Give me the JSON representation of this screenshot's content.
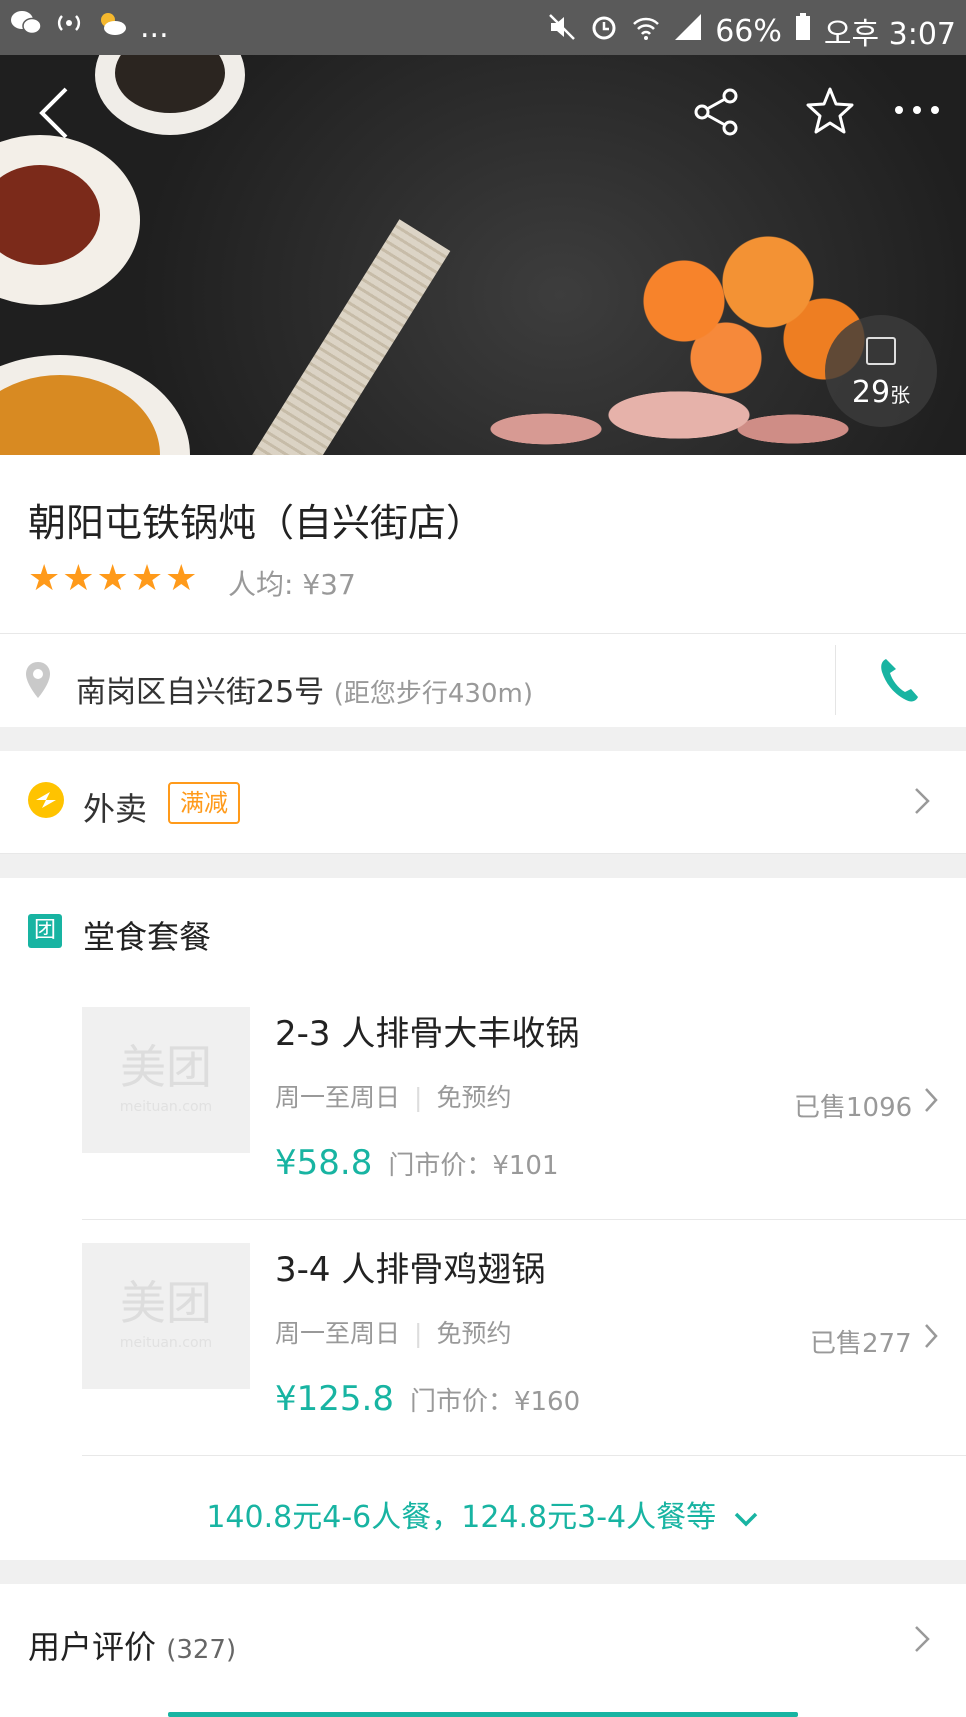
{
  "status_bar": {
    "left_icons": [
      "wechat-icon",
      "hotspot-icon",
      "weather-icon"
    ],
    "left_more": "...",
    "battery": "66%",
    "time": "오후 3:07"
  },
  "hero": {
    "photo_count": "29",
    "photo_unit": "张"
  },
  "shop": {
    "name": "朝阳屯铁锅炖（自兴街店）",
    "stars": "★★★★★",
    "avg_price": "人均: ¥37",
    "address": "南岗区自兴街25号",
    "distance": "(距您步行430m)"
  },
  "delivery": {
    "label": "外卖",
    "badge": "满减"
  },
  "dine_in": {
    "section_icon_text": "团",
    "title": "堂食套餐",
    "thumb_placeholder": "美团",
    "thumb_placeholder_sub": "meituan.com",
    "packages": [
      {
        "name": "2-3 人排骨大丰收锅",
        "days": "周一至周日",
        "booking": "免预约",
        "price": "¥58.8",
        "original": "门市价：¥101",
        "sold": "已售1096"
      },
      {
        "name": "3-4 人排骨鸡翅锅",
        "days": "周一至周日",
        "booking": "免预约",
        "price": "¥125.8",
        "original": "门市价：¥160",
        "sold": "已售277"
      }
    ],
    "more_link": "140.8元4-6人餐，124.8元3-4人餐等"
  },
  "reviews": {
    "label": "用户评价",
    "count": "(327)"
  }
}
